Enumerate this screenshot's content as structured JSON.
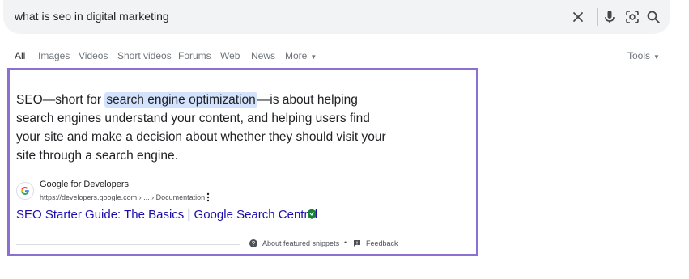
{
  "search": {
    "query": "what is seo in digital marketing",
    "icons": [
      "clear-icon",
      "microphone-icon",
      "lens-icon",
      "search-icon"
    ]
  },
  "tabs": {
    "all": "All",
    "images": "Images",
    "videos": "Videos",
    "short_videos": "Short videos",
    "forums": "Forums",
    "web": "Web",
    "news": "News",
    "more": "More",
    "tools": "Tools"
  },
  "snippet": {
    "text_before": "SEO—short for ",
    "highlight": "search engine optimization",
    "text_after": "—is about helping search engines understand your content, and helping users find your site and make a decision about whether they should visit your site through a search engine.",
    "source_name": "Google for Developers",
    "source_url": "https://developers.google.com › ... › Documentation",
    "link_title": "SEO Starter Guide: The Basics | Google Search Central",
    "about_label": "About featured snippets",
    "separator": "•",
    "feedback_label": "Feedback"
  },
  "colors": {
    "highlight_border": "#8c6fd3",
    "link": "#1a0dab",
    "highlight_bg": "#d3e3fd"
  }
}
